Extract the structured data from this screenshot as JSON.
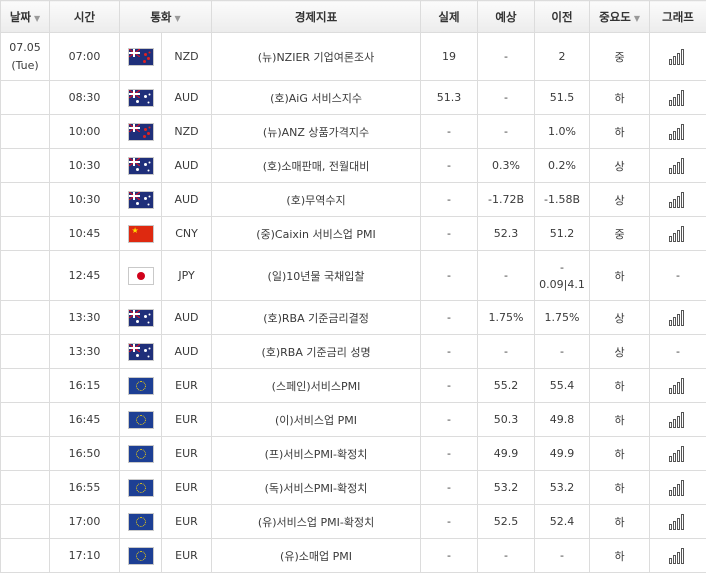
{
  "headers": {
    "date": "날짜",
    "time": "시간",
    "currency": "통화",
    "indicator": "경제지표",
    "actual": "실제",
    "forecast": "예상",
    "previous": "이전",
    "importance": "중요도",
    "graph": "그래프"
  },
  "date_cell": {
    "date": "07.05",
    "weekday": "(Tue)"
  },
  "events": [
    {
      "time": "07:00",
      "flag": "nz",
      "currency": "NZD",
      "indicator": "(뉴)NZIER 기업여론조사",
      "actual": "19",
      "forecast": "-",
      "previous": "2",
      "importance": "중",
      "graph": true
    },
    {
      "time": "08:30",
      "flag": "au",
      "currency": "AUD",
      "indicator": "(호)AiG 서비스지수",
      "actual": "51.3",
      "forecast": "-",
      "previous": "51.5",
      "importance": "하",
      "graph": true
    },
    {
      "time": "10:00",
      "flag": "nz",
      "currency": "NZD",
      "indicator": "(뉴)ANZ 상품가격지수",
      "actual": "-",
      "forecast": "-",
      "previous": "1.0%",
      "importance": "하",
      "graph": true
    },
    {
      "time": "10:30",
      "flag": "au",
      "currency": "AUD",
      "indicator": "(호)소매판매, 전월대비",
      "actual": "-",
      "forecast": "0.3%",
      "previous": "0.2%",
      "importance": "상",
      "graph": true
    },
    {
      "time": "10:30",
      "flag": "au",
      "currency": "AUD",
      "indicator": "(호)무역수지",
      "actual": "-",
      "forecast": "-1.72B",
      "previous": "-1.58B",
      "importance": "상",
      "graph": true
    },
    {
      "time": "10:45",
      "flag": "cn",
      "currency": "CNY",
      "indicator": "(중)Caixin 서비스업 PMI",
      "actual": "-",
      "forecast": "52.3",
      "previous": "51.2",
      "importance": "중",
      "graph": true
    },
    {
      "time": "12:45",
      "flag": "jp",
      "currency": "JPY",
      "indicator": "(일)10년물 국채입찰",
      "actual": "-",
      "forecast": "-",
      "previous": "-",
      "previous_line2": "0.09|4.1",
      "importance": "하",
      "graph": false,
      "graph_text": "-"
    },
    {
      "time": "13:30",
      "flag": "au",
      "currency": "AUD",
      "indicator": "(호)RBA 기준금리결정",
      "actual": "-",
      "forecast": "1.75%",
      "previous": "1.75%",
      "importance": "상",
      "graph": true
    },
    {
      "time": "13:30",
      "flag": "au",
      "currency": "AUD",
      "indicator": "(호)RBA 기준금리 성명",
      "actual": "-",
      "forecast": "-",
      "previous": "-",
      "importance": "상",
      "graph": false,
      "graph_text": "-"
    },
    {
      "time": "16:15",
      "flag": "eu",
      "currency": "EUR",
      "indicator": "(스페인)서비스PMI",
      "actual": "-",
      "forecast": "55.2",
      "previous": "55.4",
      "importance": "하",
      "graph": true
    },
    {
      "time": "16:45",
      "flag": "eu",
      "currency": "EUR",
      "indicator": "(이)서비스업 PMI",
      "actual": "-",
      "forecast": "50.3",
      "previous": "49.8",
      "importance": "하",
      "graph": true
    },
    {
      "time": "16:50",
      "flag": "eu",
      "currency": "EUR",
      "indicator": "(프)서비스PMI-확정치",
      "actual": "-",
      "forecast": "49.9",
      "previous": "49.9",
      "importance": "하",
      "graph": true
    },
    {
      "time": "16:55",
      "flag": "eu",
      "currency": "EUR",
      "indicator": "(독)서비스PMI-확정치",
      "actual": "-",
      "forecast": "53.2",
      "previous": "53.2",
      "importance": "하",
      "graph": true
    },
    {
      "time": "17:00",
      "flag": "eu",
      "currency": "EUR",
      "indicator": "(유)서비스업 PMI-확정치",
      "actual": "-",
      "forecast": "52.5",
      "previous": "52.4",
      "importance": "하",
      "graph": true
    },
    {
      "time": "17:10",
      "flag": "eu",
      "currency": "EUR",
      "indicator": "(유)소매업 PMI",
      "actual": "-",
      "forecast": "-",
      "previous": "-",
      "importance": "하",
      "graph": true
    }
  ]
}
